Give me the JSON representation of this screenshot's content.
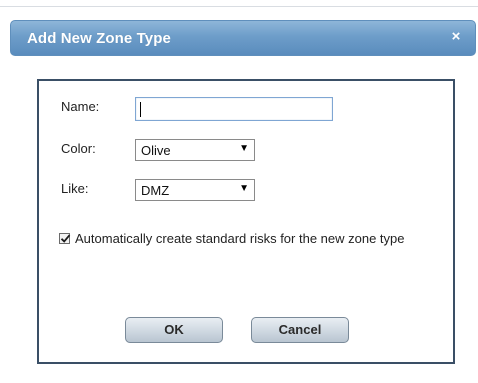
{
  "dialog": {
    "title": "Add New Zone Type",
    "close_glyph": "×",
    "close_icon": "close-icon"
  },
  "form": {
    "name_label": "Name:",
    "name_value": "",
    "color_label": "Color:",
    "color_value": "Olive",
    "like_label": "Like:",
    "like_value": "DMZ",
    "dropdown_arrow": "▼",
    "auto_risks_checked": true,
    "auto_risks_text": "Automatically create standard risks for the new zone type"
  },
  "buttons": {
    "ok": "OK",
    "cancel": "Cancel"
  },
  "colors": {
    "titlebar": "#6d9dc9",
    "panel_border": "#3a4f66",
    "input_border": "#7fa6d3"
  }
}
